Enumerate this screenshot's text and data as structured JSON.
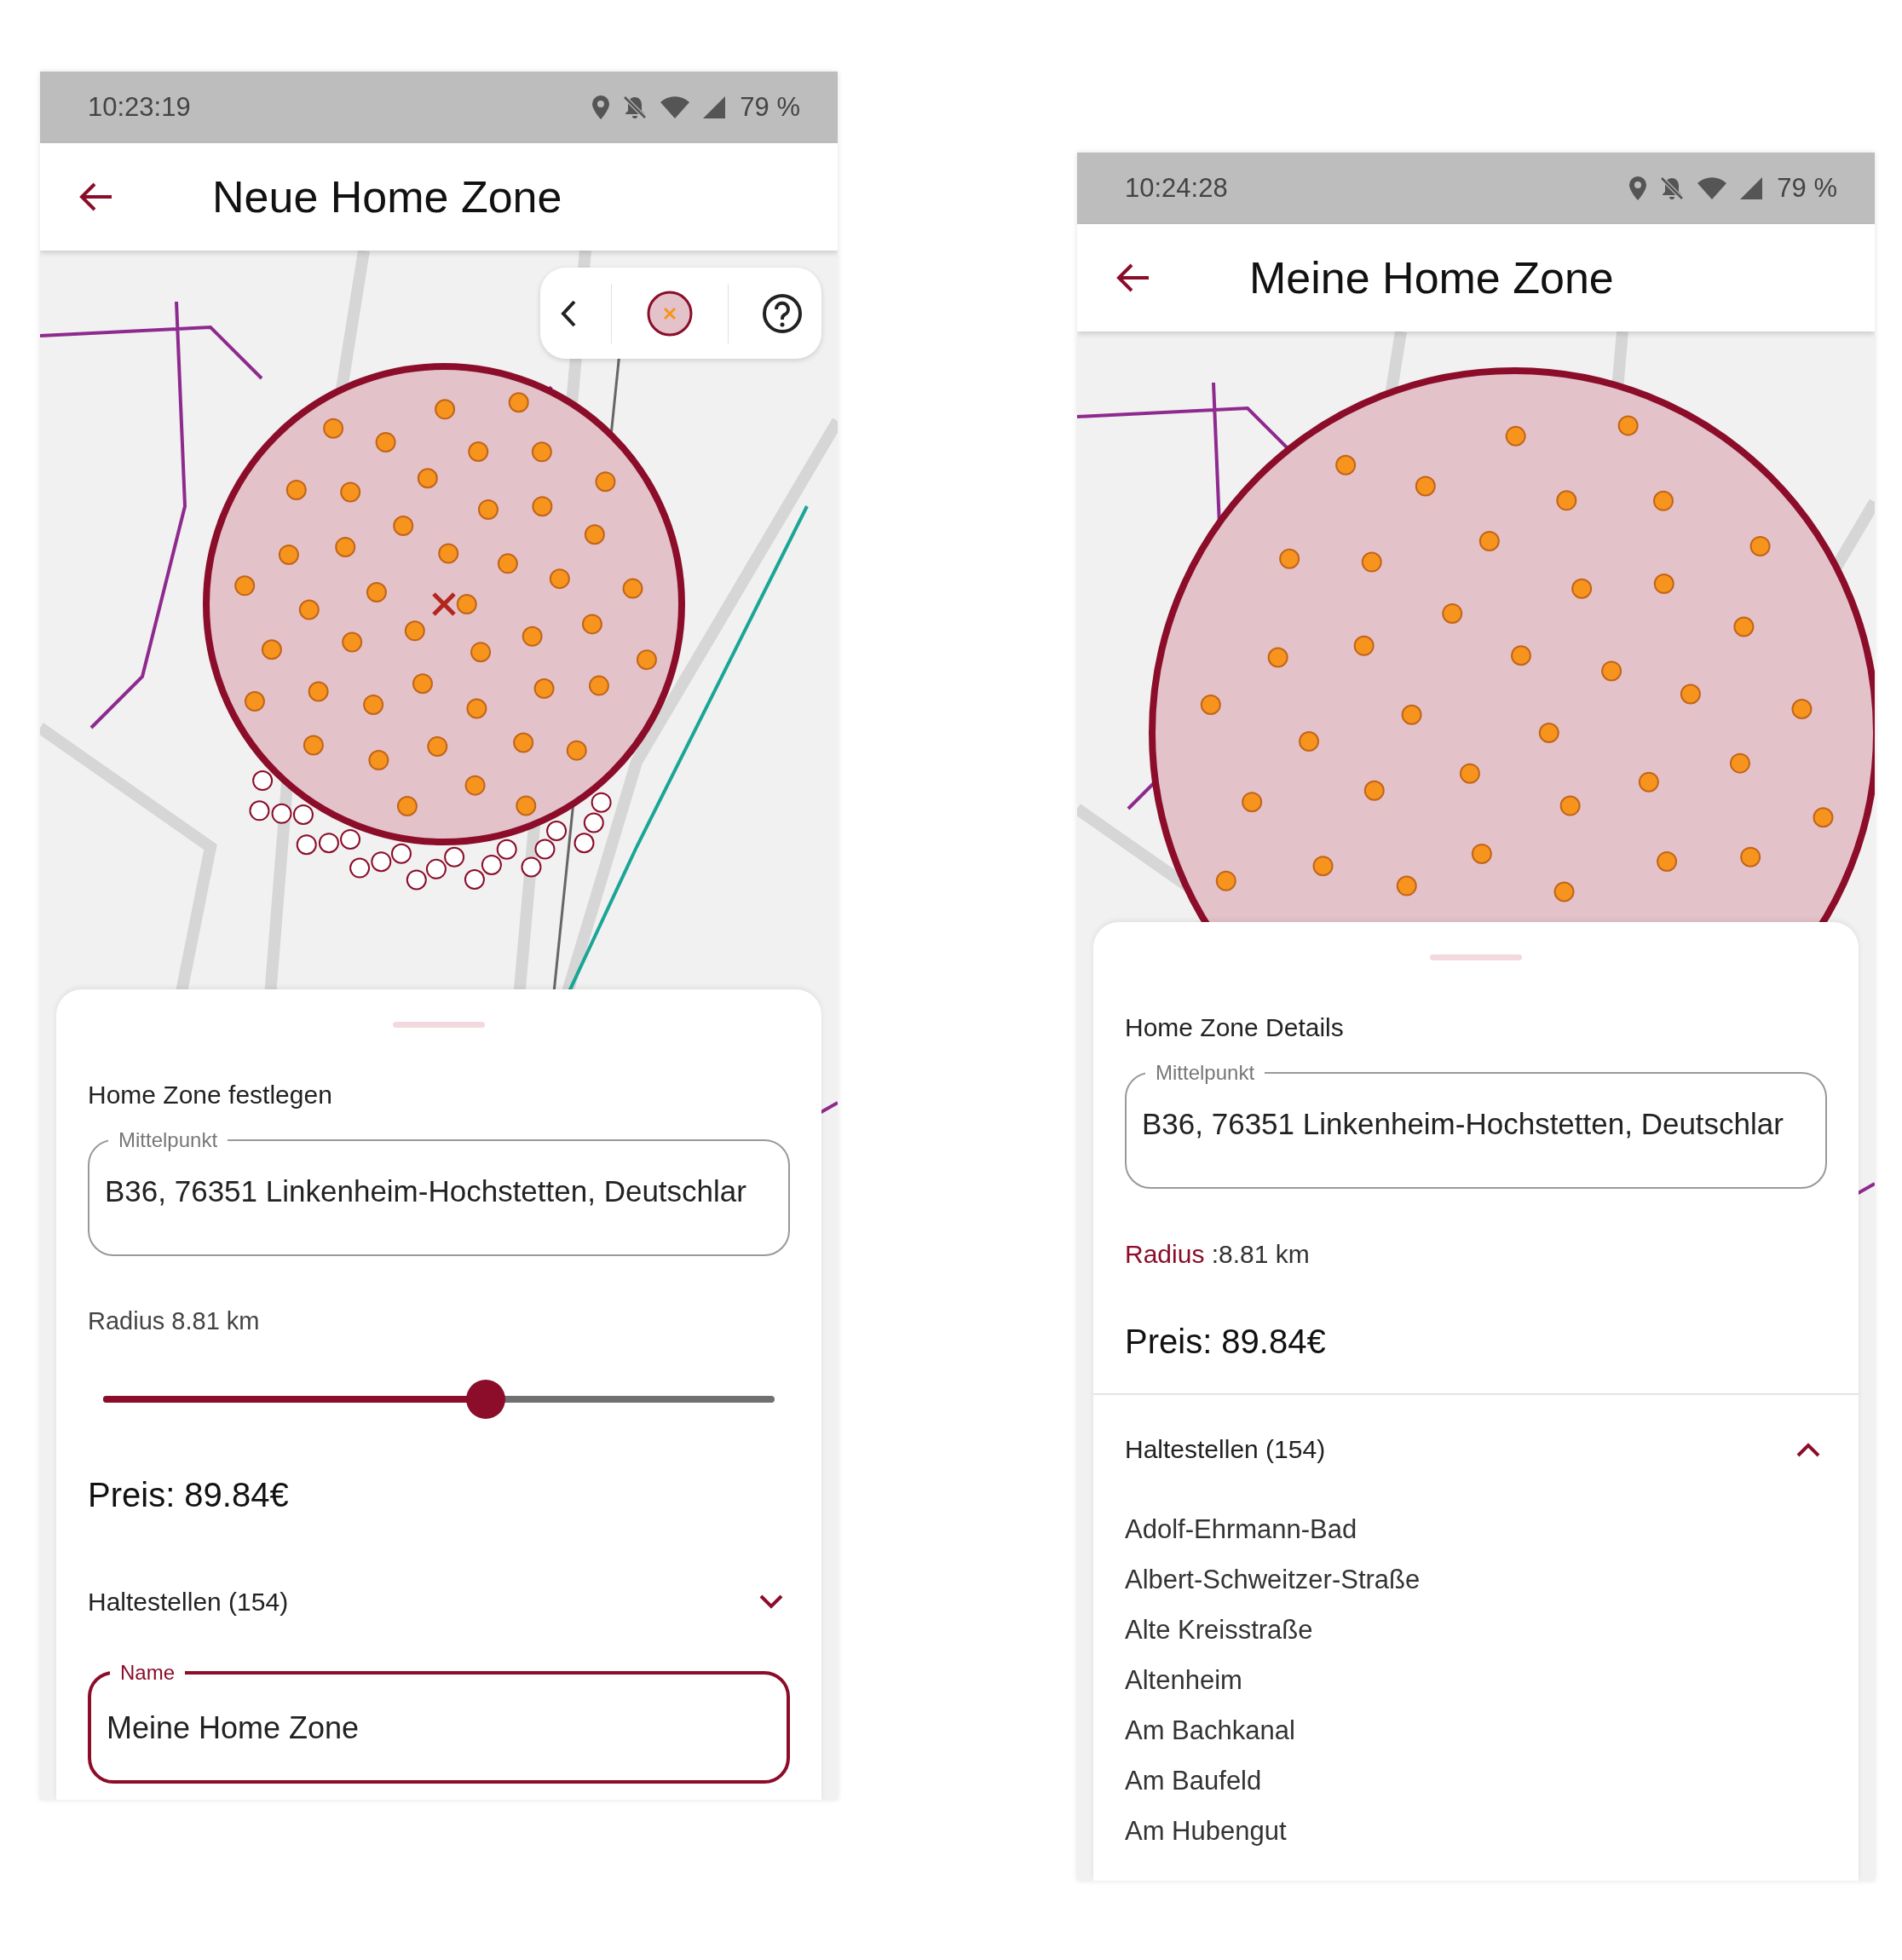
{
  "screens": [
    {
      "status_bar": {
        "time": "10:23:19",
        "battery": "79 %"
      },
      "app_bar": {
        "title": "Neue Home Zone"
      },
      "map_toolbar": {
        "buttons": [
          {
            "kind": "back"
          },
          {
            "kind": "zone"
          },
          {
            "kind": "help"
          }
        ]
      },
      "sheet": {
        "title": "Home Zone festlegen",
        "center_field": {
          "label": "Mittelpunkt",
          "value": "B36, 76351 Linkenheim-Hochstetten, Deutschlar"
        },
        "radius": {
          "kind": "slider",
          "label": "Radius 8.81 km",
          "level": 0.57
        },
        "price": "Preis: 89.84€",
        "stops": {
          "label": "Haltestellen (154)",
          "expanded": false
        },
        "name_field": {
          "label": "Name",
          "value": "Meine Home Zone",
          "focused": true
        }
      }
    },
    {
      "status_bar": {
        "time": "10:24:28",
        "battery": "79 %"
      },
      "app_bar": {
        "title": "Meine Home Zone"
      },
      "sheet": {
        "title": "Home Zone Details",
        "center_field": {
          "label": "Mittelpunkt",
          "value": "B36, 76351 Linkenheim-Hochstetten, Deutschlar"
        },
        "radius": {
          "kind": "text",
          "label": "Radius",
          "value": ":8.81 km"
        },
        "price": "Preis: 89.84€",
        "stops": {
          "label": "Haltestellen (154)",
          "expanded": true,
          "items": [
            "Adolf-Ehrmann-Bad",
            "Albert-Schweitzer-Straße",
            "Alte Kreisstraße",
            "Altenheim",
            "Am Bachkanal",
            "Am Baufeld",
            "Am Hubengut"
          ]
        }
      }
    }
  ]
}
